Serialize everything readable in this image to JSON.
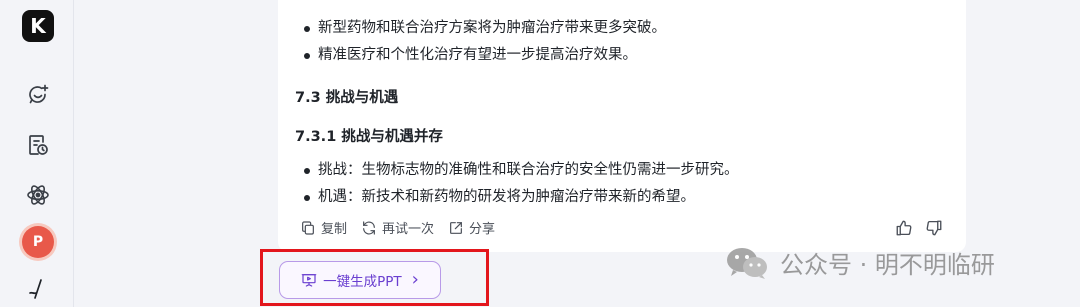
{
  "sidebar": {
    "logo_letter": "K",
    "ppt_letter": "P"
  },
  "content": {
    "bullets_top": [
      "新型药物和联合治疗方案将为肿瘤治疗带来更多突破。",
      "精准医疗和个性化治疗有望进一步提高治疗效果。"
    ],
    "heading_1": "7.3 挑战与机遇",
    "heading_2": "7.3.1 挑战与机遇并存",
    "bullets_bottom": [
      "挑战：生物标志物的准确性和联合治疗的安全性仍需进一步研究。",
      "机遇：新技术和新药物的研发将为肿瘤治疗带来新的希望。"
    ]
  },
  "actions": {
    "copy_label": "复制",
    "retry_label": "再试一次",
    "share_label": "分享"
  },
  "ppt_button": {
    "label": "一键生成PPT",
    "chevron": "›"
  },
  "watermark": {
    "text": "公众号 · 明不明临研"
  },
  "colors": {
    "accent_purple": "#6a3fd0",
    "highlight_red": "#e3161c",
    "ppt_orange": "#e8594a"
  }
}
